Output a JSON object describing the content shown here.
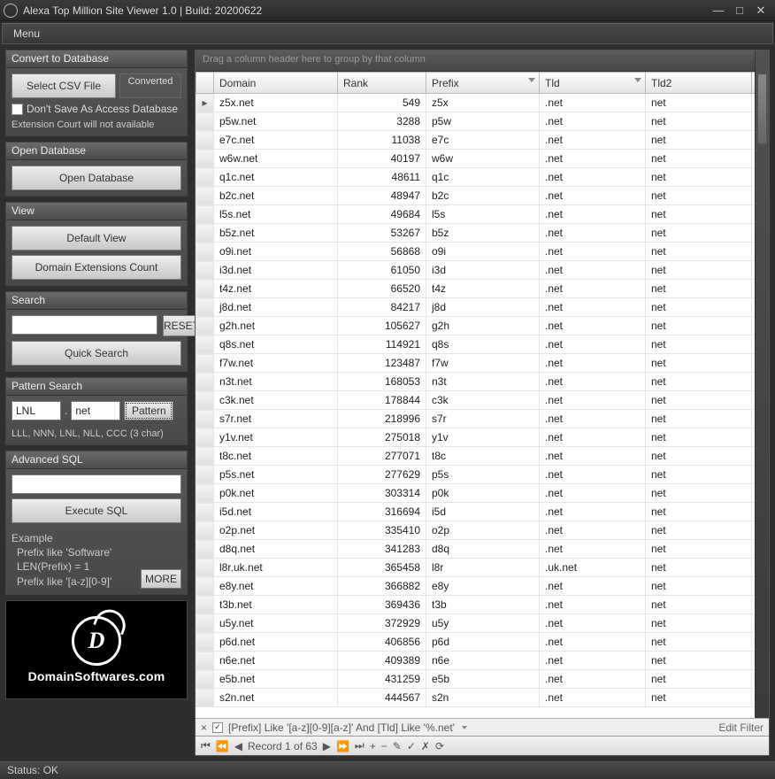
{
  "title": "Alexa Top Million Site Viewer 1.0 | Build: 20200622",
  "menu": {
    "label": "Menu"
  },
  "panels": {
    "convert": {
      "title": "Convert to Database",
      "select": "Select CSV File",
      "converted": "Converted",
      "nosave": "Don't Save As Access Database",
      "ext": "Extension Court will not available"
    },
    "opendb": {
      "title": "Open Database",
      "btn": "Open Database"
    },
    "view": {
      "title": "View",
      "default": "Default View",
      "ext": "Domain Extensions Count"
    },
    "search": {
      "title": "Search",
      "reset": "RESET",
      "quick": "Quick Search",
      "value": ""
    },
    "pattern": {
      "title": "Pattern Search",
      "v1": "LNL",
      "v2": "net",
      "btn": "Pattern",
      "hint": "LLL, NNN, LNL, NLL, CCC (3 char)"
    },
    "adv": {
      "title": "Advanced SQL",
      "exec": "Execute SQL",
      "value": "",
      "example_lbl": "Example",
      "l1": "Prefix like 'Software'",
      "l2": "LEN(Prefix) = 1",
      "l3": "Prefix like '[a-z][0-9]'",
      "more": "MORE"
    }
  },
  "logo": {
    "text": "DomainSoftwares.com",
    "d": "D"
  },
  "grid": {
    "group_hint": "Drag a column header here to group by that column",
    "cols": [
      "Domain",
      "Rank",
      "Prefix",
      "Tld",
      "Tld2"
    ],
    "rows": [
      {
        "d": "z5x.net",
        "r": 549,
        "p": "z5x",
        "t": ".net",
        "t2": "net",
        "cur": true
      },
      {
        "d": "p5w.net",
        "r": 3288,
        "p": "p5w",
        "t": ".net",
        "t2": "net"
      },
      {
        "d": "e7c.net",
        "r": 11038,
        "p": "e7c",
        "t": ".net",
        "t2": "net"
      },
      {
        "d": "w6w.net",
        "r": 40197,
        "p": "w6w",
        "t": ".net",
        "t2": "net"
      },
      {
        "d": "q1c.net",
        "r": 48611,
        "p": "q1c",
        "t": ".net",
        "t2": "net"
      },
      {
        "d": "b2c.net",
        "r": 48947,
        "p": "b2c",
        "t": ".net",
        "t2": "net"
      },
      {
        "d": "l5s.net",
        "r": 49684,
        "p": "l5s",
        "t": ".net",
        "t2": "net"
      },
      {
        "d": "b5z.net",
        "r": 53267,
        "p": "b5z",
        "t": ".net",
        "t2": "net"
      },
      {
        "d": "o9i.net",
        "r": 56868,
        "p": "o9i",
        "t": ".net",
        "t2": "net"
      },
      {
        "d": "i3d.net",
        "r": 61050,
        "p": "i3d",
        "t": ".net",
        "t2": "net"
      },
      {
        "d": "t4z.net",
        "r": 66520,
        "p": "t4z",
        "t": ".net",
        "t2": "net"
      },
      {
        "d": "j8d.net",
        "r": 84217,
        "p": "j8d",
        "t": ".net",
        "t2": "net"
      },
      {
        "d": "g2h.net",
        "r": 105627,
        "p": "g2h",
        "t": ".net",
        "t2": "net"
      },
      {
        "d": "q8s.net",
        "r": 114921,
        "p": "q8s",
        "t": ".net",
        "t2": "net"
      },
      {
        "d": "f7w.net",
        "r": 123487,
        "p": "f7w",
        "t": ".net",
        "t2": "net"
      },
      {
        "d": "n3t.net",
        "r": 168053,
        "p": "n3t",
        "t": ".net",
        "t2": "net"
      },
      {
        "d": "c3k.net",
        "r": 178844,
        "p": "c3k",
        "t": ".net",
        "t2": "net"
      },
      {
        "d": "s7r.net",
        "r": 218996,
        "p": "s7r",
        "t": ".net",
        "t2": "net"
      },
      {
        "d": "y1v.net",
        "r": 275018,
        "p": "y1v",
        "t": ".net",
        "t2": "net"
      },
      {
        "d": "t8c.net",
        "r": 277071,
        "p": "t8c",
        "t": ".net",
        "t2": "net"
      },
      {
        "d": "p5s.net",
        "r": 277629,
        "p": "p5s",
        "t": ".net",
        "t2": "net"
      },
      {
        "d": "p0k.net",
        "r": 303314,
        "p": "p0k",
        "t": ".net",
        "t2": "net"
      },
      {
        "d": "i5d.net",
        "r": 316694,
        "p": "i5d",
        "t": ".net",
        "t2": "net"
      },
      {
        "d": "o2p.net",
        "r": 335410,
        "p": "o2p",
        "t": ".net",
        "t2": "net"
      },
      {
        "d": "d8q.net",
        "r": 341283,
        "p": "d8q",
        "t": ".net",
        "t2": "net"
      },
      {
        "d": "l8r.uk.net",
        "r": 365458,
        "p": "l8r",
        "t": ".uk.net",
        "t2": "net"
      },
      {
        "d": "e8y.net",
        "r": 366882,
        "p": "e8y",
        "t": ".net",
        "t2": "net"
      },
      {
        "d": "t3b.net",
        "r": 369436,
        "p": "t3b",
        "t": ".net",
        "t2": "net"
      },
      {
        "d": "u5y.net",
        "r": 372929,
        "p": "u5y",
        "t": ".net",
        "t2": "net"
      },
      {
        "d": "p6d.net",
        "r": 406856,
        "p": "p6d",
        "t": ".net",
        "t2": "net"
      },
      {
        "d": "n6e.net",
        "r": 409389,
        "p": "n6e",
        "t": ".net",
        "t2": "net"
      },
      {
        "d": "e5b.net",
        "r": 431259,
        "p": "e5b",
        "t": ".net",
        "t2": "net"
      },
      {
        "d": "s2n.net",
        "r": 444567,
        "p": "s2n",
        "t": ".net",
        "t2": "net"
      }
    ],
    "filter_text": "[Prefix] Like '[a-z][0-9][a-z]' And [Tld] Like '%.net'",
    "edit_filter": "Edit Filter",
    "record": "Record 1 of 63"
  },
  "status": "Status: OK"
}
